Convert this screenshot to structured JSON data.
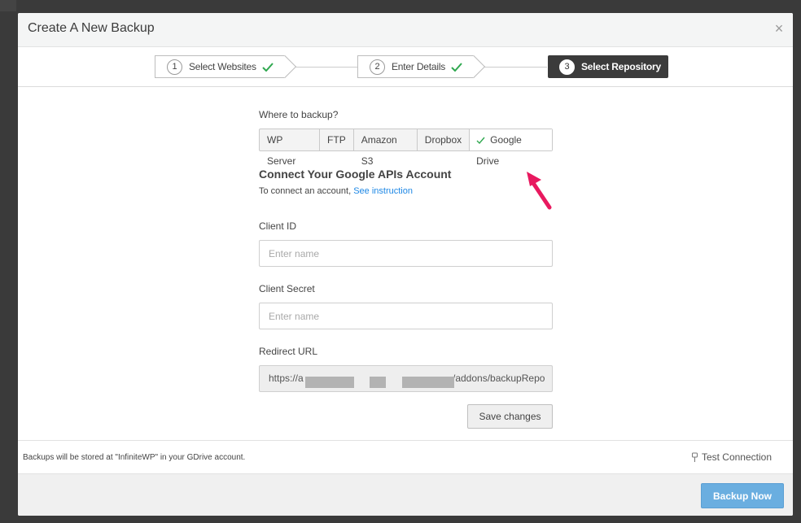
{
  "modal": {
    "title": "Create A New Backup",
    "close_glyph": "×"
  },
  "steps": [
    {
      "number": "1",
      "label": "Select Websites",
      "status": "complete"
    },
    {
      "number": "2",
      "label": "Enter Details",
      "status": "complete"
    },
    {
      "number": "3",
      "label": "Select Repository",
      "status": "active"
    }
  ],
  "form": {
    "where_label": "Where to backup?",
    "repositories": [
      {
        "label": "WP Server",
        "selected": false
      },
      {
        "label": "FTP",
        "selected": false
      },
      {
        "label": "Amazon S3",
        "selected": false
      },
      {
        "label": "Dropbox",
        "selected": false
      },
      {
        "label": "Google Drive",
        "selected": true
      }
    ],
    "section_title": "Connect Your Google APIs Account",
    "section_sub_prefix": "To connect an account,",
    "section_sub_link": "See instruction",
    "client_id": {
      "label": "Client ID",
      "placeholder": "Enter name",
      "value": ""
    },
    "client_secret": {
      "label": "Client Secret",
      "placeholder": "Enter name",
      "value": ""
    },
    "redirect_url": {
      "label": "Redirect URL",
      "value_start": "https://a",
      "value_end": "/addons/backupRepo"
    },
    "save_label": "Save changes"
  },
  "info": {
    "storage_note": "Backups will be stored at \"InfiniteWP\" in your GDrive account.",
    "test_connection": "Test Connection"
  },
  "footer": {
    "primary_label": "Backup Now"
  },
  "colors": {
    "accent_blue": "#6aaee0",
    "link_blue": "#1e88e5",
    "check_green": "#2fa84f",
    "arrow_pink": "#e8195f",
    "active_step": "#3b3b3b"
  },
  "icons": {
    "close": "close-icon",
    "check": "check-icon",
    "test": "plug-icon",
    "annotation": "arrow-annotation-icon"
  }
}
